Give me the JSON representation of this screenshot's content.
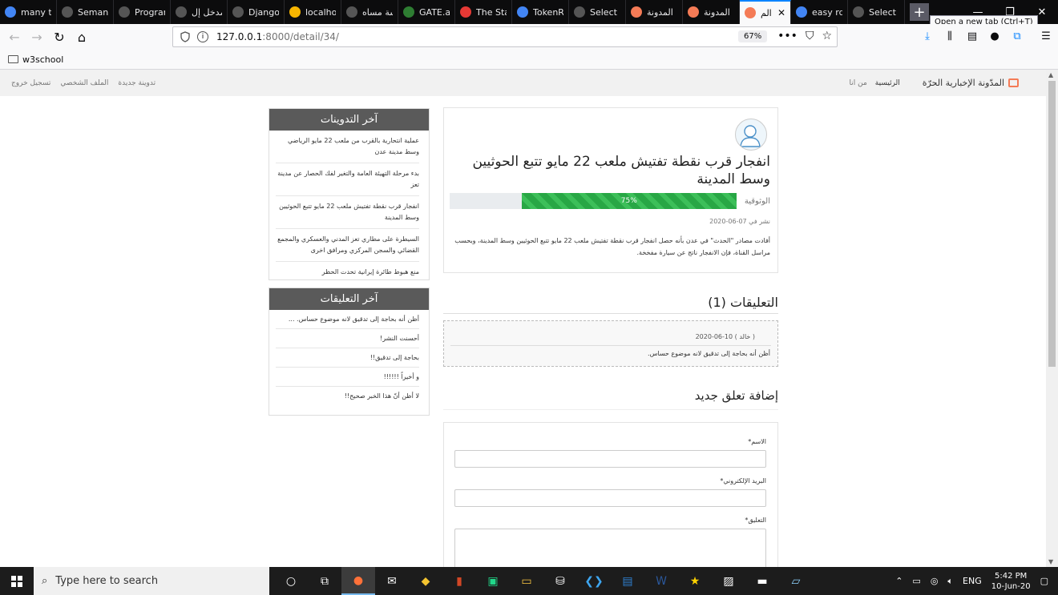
{
  "browser": {
    "tabs": [
      {
        "label": "many tv",
        "icon": "google-icon",
        "color": "#4285f4"
      },
      {
        "label": "SemanticDi",
        "icon": "page-icon",
        "color": "#555555"
      },
      {
        "label": "Programmin",
        "icon": "page-icon",
        "color": "#555555"
      },
      {
        "label": "مدخل إل",
        "icon": "page-icon",
        "color": "#555555"
      },
      {
        "label": "Django",
        "icon": "page-icon",
        "color": "#555555"
      },
      {
        "label": "localho",
        "icon": "localhost-icon",
        "color": "#f7b500"
      },
      {
        "label": "دراسة مساه",
        "icon": "page-icon",
        "color": "#555555"
      },
      {
        "label": "GATE.ac",
        "icon": "gate-icon",
        "color": "#2e7d32"
      },
      {
        "label": "The Sta",
        "icon": "page-icon",
        "color": "#e53935"
      },
      {
        "label": "TokenRe",
        "icon": "google-icon",
        "color": "#4285f4"
      },
      {
        "label": "Select com",
        "icon": "page-icon",
        "color": "#555555"
      },
      {
        "label": "المدونة",
        "icon": "blog-icon",
        "color": "#f47b56"
      },
      {
        "label": "المدونة",
        "icon": "blog-icon",
        "color": "#f47b56"
      },
      {
        "label": "الم",
        "icon": "blog-icon",
        "color": "#f47b56",
        "active": true
      },
      {
        "label": "easy rd",
        "icon": "google-icon",
        "color": "#4285f4"
      },
      {
        "label": "Select com",
        "icon": "page-icon",
        "color": "#555555"
      }
    ],
    "tooltip": "Open a new tab (Ctrl+T)",
    "url_host": "127.0.0.1",
    "url_path": ":8000/detail/34/",
    "zoom": "67%",
    "bookmark": "w3school"
  },
  "site": {
    "brand": "المدّونة الإخبارية الحرّة",
    "nav_home": "الرئيسية",
    "nav_about": "من انا",
    "nav_new_post": "تدوينة جديدة",
    "nav_profile": "الملف الشخصي",
    "nav_logout": "تسجيل خروج"
  },
  "post": {
    "title": "انفجار قرب نقطة تفتيش ملعب 22 مايو تتبع الحوثيين وسط المدينة",
    "trust_label": "الوثوقية",
    "trust_value": 75,
    "trust_text": "75%",
    "date": "نشر في 07-06-2020",
    "body": "أفادت مصادر \"الحدث\" في عدن بأنه حصل انفجار قرب نقطة تفتيش ملعب 22 مايو تتبع الحوثيين وسط المدينة، وبحسب مراسل القناة، فإن الانفجار ناتج عن سيارة مفخخة."
  },
  "comments": {
    "title": "التعليقات (1)",
    "items": [
      {
        "meta": "( خالد ) 10-06-2020",
        "text": "أظن أنه بحاجة إلى تدقيق لانه موضوع حساس."
      }
    ]
  },
  "form": {
    "title": "إضافة تعلق جديد",
    "name_label": "الاسم*",
    "email_label": "البريد الإلكتروني*",
    "comment_label": "التعليق*"
  },
  "sidebar": {
    "latest_posts_title": "آخر التدوينات",
    "latest_posts": [
      "عملية انتحارية بالقرب من ملعب 22 مايو الرياضي وسط مدينة عدن",
      "بدء مرحلة التهيئة العامة والتغير لفك الحصار عن مدينة تعز",
      "انفجار قرب نقطة تفتيش ملعب 22 مايو تتبع الحوثيين وسط المدينة",
      "السيطرة على مطاري تعز المدني والعسكري والمجمع القضائي والسجن المركزي ومرافق اخرى",
      "منع هبوط طائرة إيرانية تحدت الحظر"
    ],
    "latest_comments_title": "آخر التعليقات",
    "latest_comments": [
      "أظن أنه بحاجة إلى تدقيق لانه موضوع حساس. ...",
      "أحسنت النشر!",
      "بحاجة إلى تدقيق!!",
      "و أخيراً !!!!!!",
      "لا أظن أنّ هذا الخبر صحيح!!"
    ]
  },
  "taskbar": {
    "search_placeholder": "Type here to search",
    "lang": "ENG",
    "time": "5:42 PM",
    "date": "10-Jun-20"
  }
}
